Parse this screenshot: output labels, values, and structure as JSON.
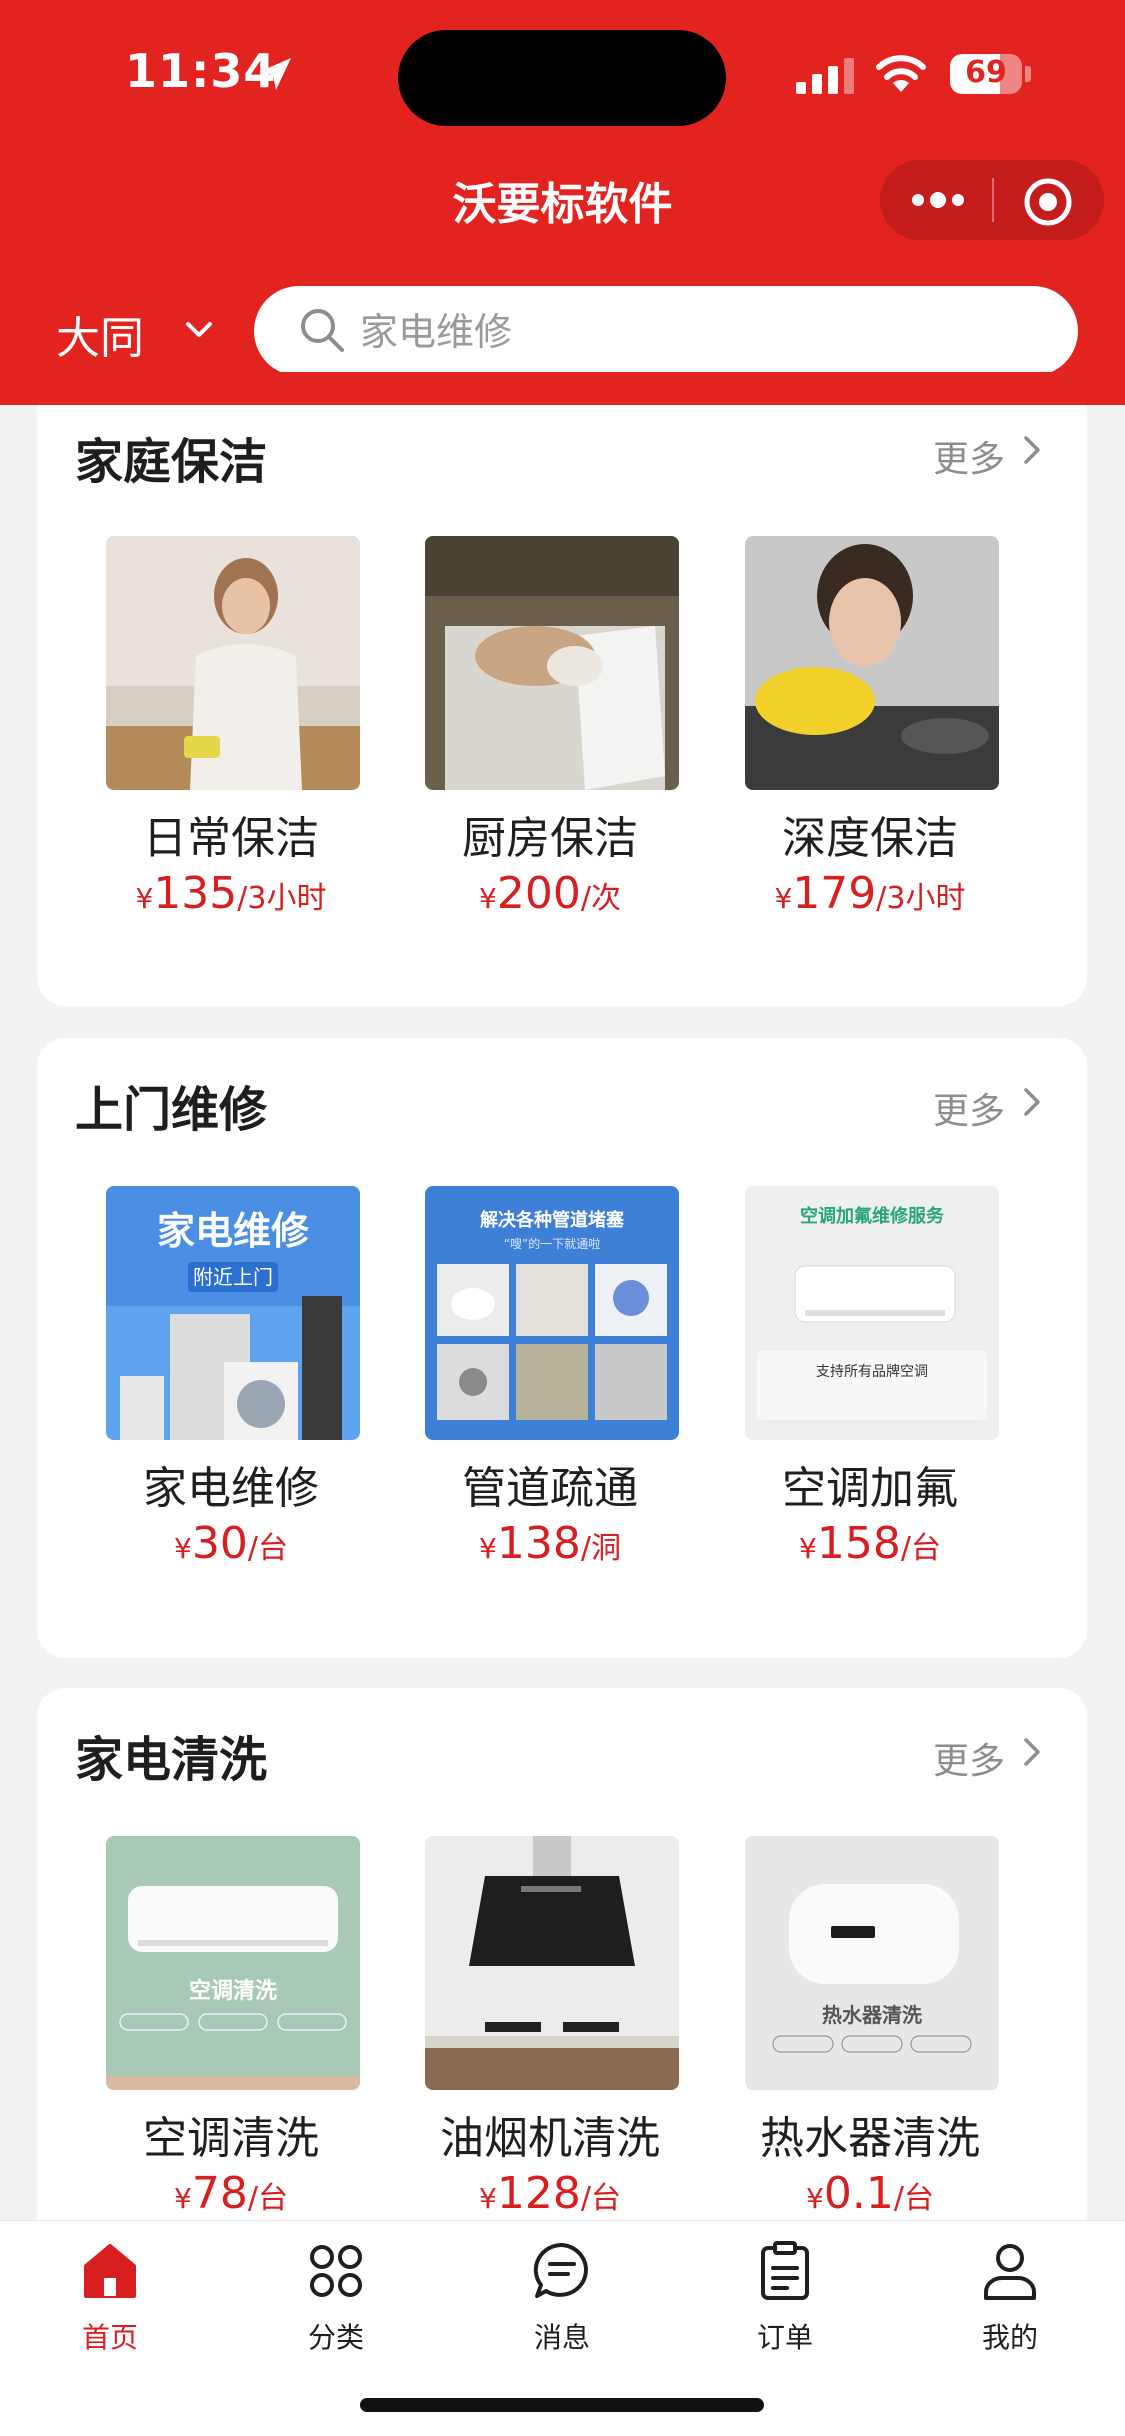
{
  "status_bar": {
    "time": "11:34",
    "battery": "69",
    "battery_level": 0.69
  },
  "header": {
    "title": "沃要标软件",
    "city": "大同",
    "search_placeholder": "家电维修"
  },
  "more_label": "更多",
  "sections": [
    {
      "title": "家庭保洁",
      "items": [
        {
          "name": "日常保洁",
          "yen": "¥",
          "price": "135",
          "unit": "/3小时"
        },
        {
          "name": "厨房保洁",
          "yen": "¥",
          "price": "200",
          "unit": "/次"
        },
        {
          "name": "深度保洁",
          "yen": "¥",
          "price": "179",
          "unit": "/3小时"
        }
      ]
    },
    {
      "title": "上门维修",
      "items": [
        {
          "name": "家电维修",
          "yen": "¥",
          "price": "30",
          "unit": "/台",
          "image_text": [
            "家电维修",
            "附近上门"
          ]
        },
        {
          "name": "管道疏通",
          "yen": "¥",
          "price": "138",
          "unit": "/洞",
          "image_text": [
            "解决各种管道堵塞",
            "“嗖”的一下就通啦"
          ]
        },
        {
          "name": "空调加氟",
          "yen": "¥",
          "price": "158",
          "unit": "/台",
          "image_text": [
            "空调加氟维修服务",
            "支持所有品牌空调"
          ]
        }
      ]
    },
    {
      "title": "家电清洗",
      "items": [
        {
          "name": "空调清洗",
          "yen": "¥",
          "price": "78",
          "unit": "/台",
          "image_text": [
            "空调清洗"
          ]
        },
        {
          "name": "油烟机清洗",
          "yen": "¥",
          "price": "128",
          "unit": "/台"
        },
        {
          "name": "热水器清洗",
          "yen": "¥",
          "price": "0.1",
          "unit": "/台",
          "image_text": [
            "热水器清洗"
          ]
        }
      ]
    }
  ],
  "tabbar": [
    {
      "label": "首页",
      "icon": "home-icon",
      "active": true
    },
    {
      "label": "分类",
      "icon": "category-icon"
    },
    {
      "label": "消息",
      "icon": "message-icon"
    },
    {
      "label": "订单",
      "icon": "order-icon"
    },
    {
      "label": "我的",
      "icon": "profile-icon"
    }
  ],
  "colors": {
    "brand": "#e32320",
    "price": "#d81e1e"
  }
}
